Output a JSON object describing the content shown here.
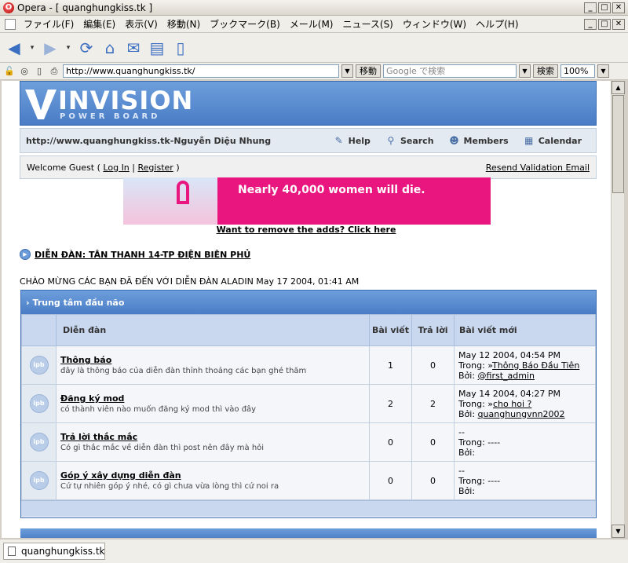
{
  "window": {
    "title": "Opera - [ quanghungkiss.tk ]",
    "min": "_",
    "max": "□",
    "close": "✕"
  },
  "menu": [
    "ファイル(F)",
    "編集(E)",
    "表示(V)",
    "移動(N)",
    "ブックマーク(B)",
    "メール(M)",
    "ニュース(S)",
    "ウィンドウ(W)",
    "ヘルプ(H)"
  ],
  "address": {
    "url": "http://www.quanghungkiss.tk/",
    "go": "移動",
    "search_placeholder": "Google で検索",
    "search_btn": "検索",
    "zoom": "100%"
  },
  "forum": {
    "logo": "INVISION",
    "logo_sub": "POWER BOARD",
    "site_label": "http://www.quanghungkiss.tk-Nguyễn Diệu Nhung",
    "nav": [
      "Help",
      "Search",
      "Members",
      "Calendar"
    ],
    "welcome_guest": "Welcome Guest (",
    "login": "Log In",
    "sep": "|",
    "register": "Register",
    "close_paren": ")",
    "resend": "Resend Validation Email",
    "ad_text": "Nearly 40,000 women will die.",
    "remove_ads": "Want to remove the adds? Click here",
    "board_link": "DIỄN ĐÀN: TÂN THANH 14-TP ĐIỆN BIÊN PHỦ",
    "welcome_line": "CHÀO MỪNG CÁC BẠN ĐÃ ĐẾN VỚI DIỄN ĐÀN ALADIN May 17 2004, 01:41 AM",
    "category": "Trung tâm đầu não",
    "headers": {
      "forum": "Diễn đàn",
      "posts": "Bài viết",
      "replies": "Trả lời",
      "last": "Bài viết mới"
    },
    "rows": [
      {
        "title": "Thông báo",
        "desc": "đây là thông báo của diễn đàn thỉnh thoảng các bạn ghé thăm",
        "posts": "1",
        "replies": "0",
        "date": "May 12 2004, 04:54 PM",
        "in_label": "Trong: »",
        "in_link": "Thông Báo Đầu Tiên",
        "by_label": "Bởi:",
        "by_link": "@first_admin"
      },
      {
        "title": "Đăng ký mod",
        "desc": "có thành viên nào muốn đăng ký mod thì vào đây",
        "posts": "2",
        "replies": "2",
        "date": "May 14 2004, 04:27 PM",
        "in_label": "Trong: »",
        "in_link": "cho hoi ?",
        "by_label": "Bởi:",
        "by_link": "quanghungvnn2002"
      },
      {
        "title": "Trả lời thắc mắc",
        "desc": "Có gì thắc mắc về diễn đàn thì post nên đây mà hỏi",
        "posts": "0",
        "replies": "0",
        "date": "--",
        "in_label": "Trong: ----",
        "in_link": "",
        "by_label": "Bởi:",
        "by_link": ""
      },
      {
        "title": "Góp ý xây dựng diễn đàn",
        "desc": "Cứ tự nhiên góp ý nhé, có gì chưa vừa lòng thì cứ noi ra",
        "posts": "0",
        "replies": "0",
        "date": "--",
        "in_label": "Trong: ----",
        "in_link": "",
        "by_label": "Bởi:",
        "by_link": ""
      }
    ],
    "ipb": "ipb"
  },
  "status": {
    "tab": "quanghungkiss.tk"
  }
}
